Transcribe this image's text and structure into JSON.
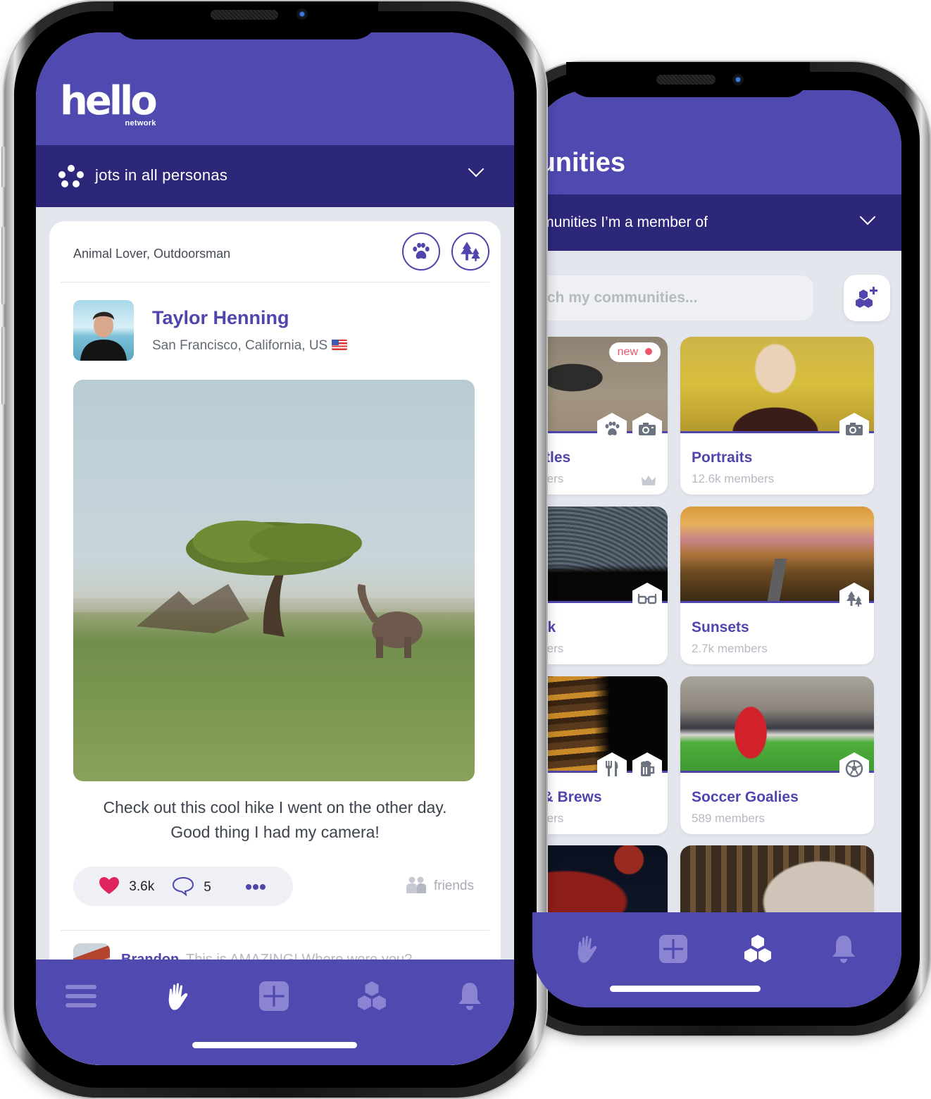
{
  "front_app": {
    "logo": {
      "main": "hello",
      "sub": "network"
    },
    "persona_filter": {
      "label": "jots in all personas",
      "icon": "persona-dots-icon",
      "expand_icon": "chevron-down-icon"
    },
    "post": {
      "persona_tags": "Animal Lover, Outdoorsman",
      "persona_icons": [
        "paw-icon",
        "trees-icon"
      ],
      "author": {
        "name": "Taylor Henning",
        "location": "San Francisco, California, US",
        "flag": "us-flag-icon"
      },
      "photo": "savanna-tree-elephant-photo",
      "text_line1": "Check out this cool hike I went on the other day.",
      "text_line2": "Good thing I had my camera!",
      "reactions": {
        "likes": "3.6k",
        "comments": "5",
        "more_icon": "more-dots-icon"
      },
      "visibility": "friends"
    },
    "comment_preview": {
      "author": "Brandon",
      "text": "This is AMAZING! Where were you?"
    },
    "bottom_nav": [
      {
        "name": "menu",
        "icon": "menu-icon",
        "active": false
      },
      {
        "name": "jots",
        "icon": "hand-wave-icon",
        "active": true
      },
      {
        "name": "create",
        "icon": "plus-square-icon",
        "active": false
      },
      {
        "name": "communities",
        "icon": "hexagons-icon",
        "active": false
      },
      {
        "name": "notifications",
        "icon": "bell-icon",
        "active": false
      }
    ]
  },
  "back_app": {
    "title": "Communities",
    "visible_title": "mmunities",
    "filter": {
      "label": "Communities I'm a member of",
      "visible_label": "ommunities I’m a member of"
    },
    "search": {
      "placeholder": "Search my communities...",
      "visible_placeholder": "arch my communities..."
    },
    "add_community_icon": "add-community-icon",
    "communities": [
      {
        "name": "Turtles",
        "visible_name": "urtles",
        "members_visible": "mbers",
        "badge": "new",
        "icons": [
          "paw-icon",
          "camera-icon"
        ],
        "owner_icon": "crown-icon"
      },
      {
        "name": "Portraits",
        "visible_name": "Portraits",
        "members_visible": "12.6k members",
        "icons": [
          "camera-icon"
        ]
      },
      {
        "name": "talk",
        "visible_name": "talk",
        "members_visible": "mbers",
        "icons": [
          "glasses-icon"
        ]
      },
      {
        "name": "Sunsets",
        "visible_name": "Sunsets",
        "members_visible": "2.7k members",
        "icons": [
          "trees-icon"
        ]
      },
      {
        "name": "& Brews",
        "visible_name": "s & Brews",
        "members_visible": "mbers",
        "icons": [
          "utensils-icon",
          "beer-mug-icon"
        ]
      },
      {
        "name": "Soccer Goalies",
        "visible_name": "Soccer Goalies",
        "members_visible": "589 members",
        "icons": [
          "soccer-ball-icon"
        ]
      },
      {
        "name": "",
        "visible_name": "",
        "members_visible": "",
        "icons": []
      },
      {
        "name": "",
        "visible_name": "",
        "members_visible": "",
        "icons": []
      }
    ],
    "bottom_nav": [
      {
        "name": "jots",
        "icon": "hand-wave-icon",
        "active": false
      },
      {
        "name": "create",
        "icon": "plus-square-icon",
        "active": false
      },
      {
        "name": "communities",
        "icon": "hexagons-icon",
        "active": true
      },
      {
        "name": "notifications",
        "icon": "bell-icon",
        "active": false
      }
    ]
  },
  "colors": {
    "brand_purple": "#5049b0",
    "dark_purple": "#2d2779",
    "feed_background": "#e4e6ee",
    "like_red": "#e0245e",
    "new_badge": "#f0566a",
    "inactive_icon": "#8a84d2",
    "muted_text": "#b6b9c2"
  }
}
